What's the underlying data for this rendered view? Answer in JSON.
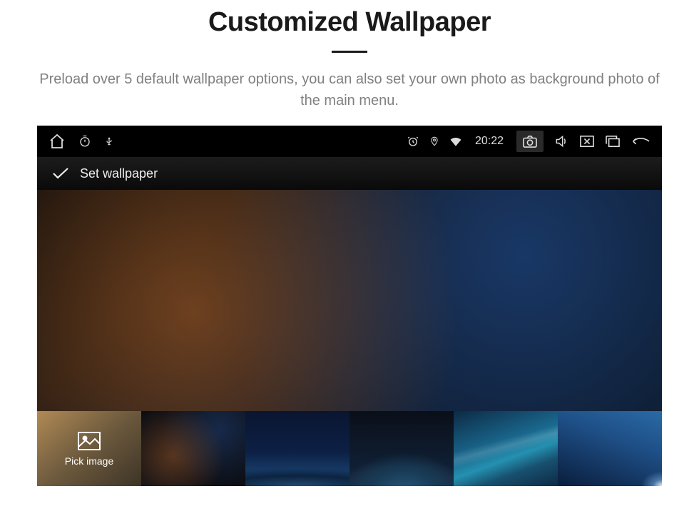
{
  "heading": "Customized Wallpaper",
  "subtitle": "Preload over 5 default wallpaper options, you can also set your own photo as background photo of the main menu.",
  "status": {
    "time": "20:22"
  },
  "titlebar": {
    "label": "Set wallpaper"
  },
  "thumbs": {
    "pick_label": "Pick image"
  }
}
